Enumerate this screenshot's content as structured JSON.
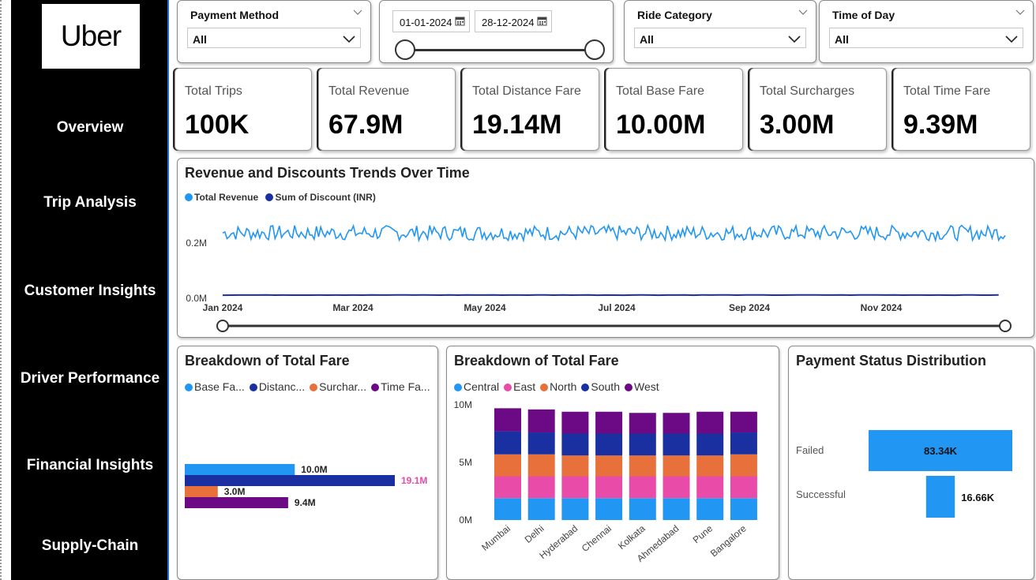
{
  "logo": "Uber",
  "nav": [
    "Overview",
    "Trip Analysis",
    "Customer Insights",
    "Driver Performance",
    "Financial Insights",
    "Supply-Chain"
  ],
  "filters": {
    "payment_method": {
      "title": "Payment Method",
      "value": "All"
    },
    "date_range": {
      "start": "01-01-2024",
      "end": "28-12-2024"
    },
    "ride_category": {
      "title": "Ride Category",
      "value": "All"
    },
    "time_of_day": {
      "title": "Time of Day",
      "value": "All"
    }
  },
  "kpis": [
    {
      "label": "Total Trips",
      "value": "100K"
    },
    {
      "label": "Total Revenue",
      "value": "67.9M"
    },
    {
      "label": "Total Distance Fare",
      "value": "19.14M"
    },
    {
      "label": "Total Base Fare",
      "value": "10.00M"
    },
    {
      "label": "Total Surcharges",
      "value": "3.00M"
    },
    {
      "label": "Total Time Fare",
      "value": "9.39M"
    }
  ],
  "trend": {
    "title": "Revenue and Discounts Trends Over Time",
    "legend": [
      {
        "label": "Total Revenue",
        "color": "#2196f3"
      },
      {
        "label": "Sum of Discount (INR)",
        "color": "#1a2fa0"
      }
    ]
  },
  "fare_breakdown": {
    "title": "Breakdown of Total Fare",
    "legend": [
      {
        "label": "Base Fa...",
        "color": "#2196f3"
      },
      {
        "label": "Distanc...",
        "color": "#1a2fa0"
      },
      {
        "label": "Surchar...",
        "color": "#e8703a"
      },
      {
        "label": "Time Fa...",
        "color": "#6b0a84"
      }
    ]
  },
  "city_breakdown": {
    "title": "Breakdown of Total Fare",
    "legend": [
      {
        "label": "Central",
        "color": "#2196f3"
      },
      {
        "label": "East",
        "color": "#e84ba8"
      },
      {
        "label": "North",
        "color": "#e8703a"
      },
      {
        "label": "South",
        "color": "#1a2fa0"
      },
      {
        "label": "West",
        "color": "#6b0a84"
      }
    ]
  },
  "payment_status": {
    "title": "Payment Status Distribution"
  },
  "chart_data": [
    {
      "type": "line",
      "title": "Revenue and Discounts Trends Over Time",
      "x_ticks": [
        "Jan 2024",
        "Mar 2024",
        "May 2024",
        "Jul 2024",
        "Sep 2024",
        "Nov 2024"
      ],
      "y_ticks": [
        "0.0M",
        "0.2M"
      ],
      "ylim": [
        0,
        0.27
      ],
      "series": [
        {
          "name": "Total Revenue",
          "approx_daily_value_M": 0.19,
          "color": "#2196f3"
        },
        {
          "name": "Sum of Discount (INR)",
          "approx_daily_value_M": 0.005,
          "color": "#1a2fa0"
        }
      ]
    },
    {
      "type": "bar",
      "orientation": "horizontal",
      "title": "Breakdown of Total Fare",
      "series": [
        {
          "name": "Base Fa...",
          "value": 10.0,
          "label": "10.0M",
          "color": "#2196f3"
        },
        {
          "name": "Distanc...",
          "value": 19.1,
          "label": "19.1M",
          "color": "#1a2fa0"
        },
        {
          "name": "Surchar...",
          "value": 3.0,
          "label": "3.0M",
          "color": "#e8703a"
        },
        {
          "name": "Time Fa...",
          "value": 9.4,
          "label": "9.4M",
          "color": "#6b0a84"
        }
      ]
    },
    {
      "type": "bar",
      "stacked": true,
      "title": "Breakdown of Total Fare",
      "categories": [
        "Mumbai",
        "Delhi",
        "Hyderabad",
        "Chennai",
        "Kolkata",
        "Ahmedabad",
        "Pune",
        "Bangalore"
      ],
      "y_ticks": [
        "0M",
        "5M",
        "10M"
      ],
      "ylim": [
        0,
        10
      ],
      "series": [
        {
          "name": "Central",
          "color": "#2196f3",
          "values": [
            1.9,
            1.9,
            1.9,
            1.9,
            1.9,
            1.9,
            1.9,
            1.9
          ]
        },
        {
          "name": "East",
          "color": "#e84ba8",
          "values": [
            1.9,
            1.9,
            1.9,
            1.9,
            1.9,
            1.9,
            1.9,
            1.9
          ]
        },
        {
          "name": "North",
          "color": "#e8703a",
          "values": [
            1.9,
            1.9,
            1.8,
            1.8,
            1.8,
            1.8,
            1.8,
            1.9
          ]
        },
        {
          "name": "South",
          "color": "#1a2fa0",
          "values": [
            2.0,
            1.9,
            1.9,
            1.9,
            1.9,
            1.9,
            1.9,
            1.9
          ]
        },
        {
          "name": "West",
          "color": "#6b0a84",
          "values": [
            2.0,
            2.0,
            1.9,
            1.9,
            1.8,
            1.8,
            1.9,
            1.8
          ]
        }
      ]
    },
    {
      "type": "bar",
      "orientation": "horizontal",
      "subtype": "funnel",
      "title": "Payment Status Distribution",
      "categories": [
        "Failed",
        "Successful"
      ],
      "values": [
        83340,
        16660
      ],
      "labels": [
        "83.34K",
        "16.66K"
      ],
      "color": "#2196f3"
    }
  ]
}
